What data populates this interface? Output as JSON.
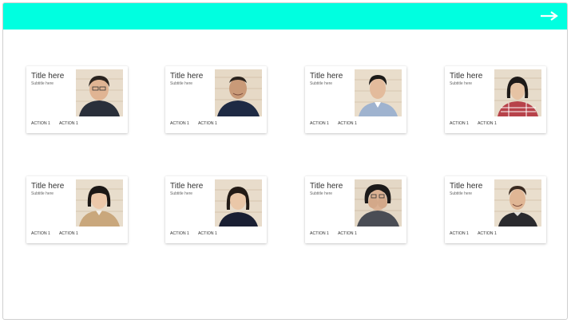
{
  "header": {
    "bg_color": "#00ffe0",
    "nav_icon": "arrow-right-icon"
  },
  "cards": [
    {
      "title": "Title here",
      "subtitle": "Subtitle here",
      "actions": [
        "ACTION 1",
        "ACTION 1"
      ]
    },
    {
      "title": "Title here",
      "subtitle": "Subtitle here",
      "actions": [
        "ACTION 1",
        "ACTION 1"
      ]
    },
    {
      "title": "Title here",
      "subtitle": "Subtitle here",
      "actions": [
        "ACTION 1",
        "ACTION 1"
      ]
    },
    {
      "title": "Title here",
      "subtitle": "Subtitle here",
      "actions": [
        "ACTION 1",
        "ACTION 1"
      ]
    },
    {
      "title": "Title here",
      "subtitle": "Subtitle here",
      "actions": [
        "ACTION 1",
        "ACTION 1"
      ]
    },
    {
      "title": "Title here",
      "subtitle": "Subtitle here",
      "actions": [
        "ACTION 1",
        "ACTION 1"
      ]
    },
    {
      "title": "Title here",
      "subtitle": "Subtitle here",
      "actions": [
        "ACTION 1",
        "ACTION 1"
      ]
    },
    {
      "title": "Title here",
      "subtitle": "Subtitle here",
      "actions": [
        "ACTION 1",
        "ACTION 1"
      ]
    }
  ]
}
